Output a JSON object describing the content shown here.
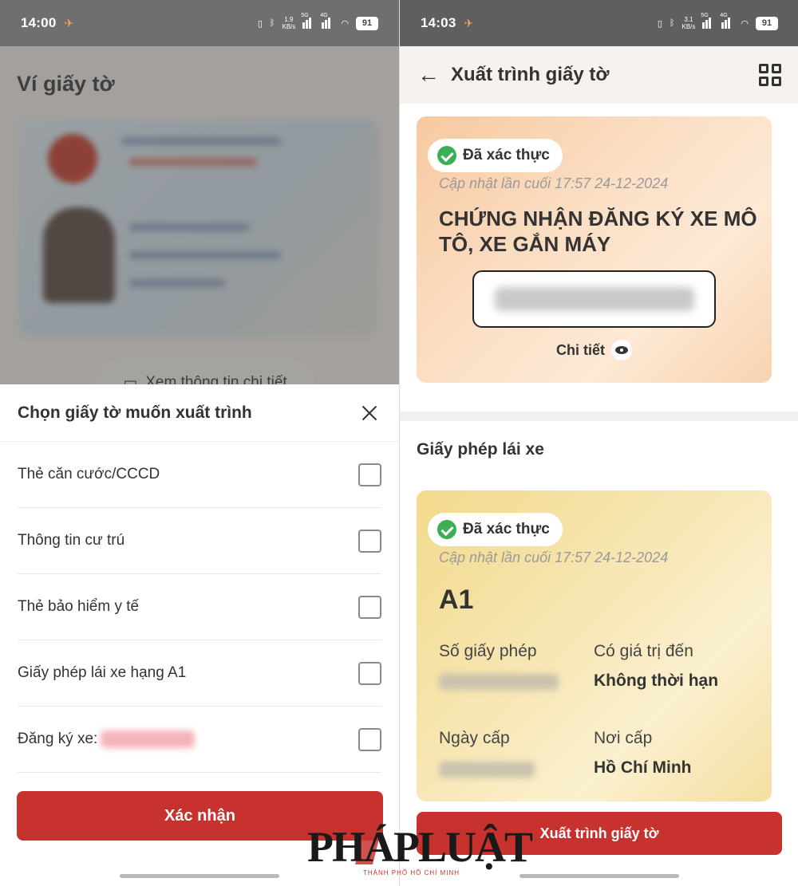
{
  "left": {
    "status": {
      "time": "14:00",
      "speed": "1.9",
      "speed_unit": "KB/s",
      "net1": "5G",
      "net2": "4G",
      "battery": "91"
    },
    "background": {
      "title": "Ví giấy tờ",
      "view_button": "Xem thông tin chi tiết"
    },
    "sheet": {
      "title": "Chọn giấy tờ muốn xuất trình",
      "options": [
        {
          "label": "Thẻ căn cước/CCCD"
        },
        {
          "label": "Thông tin cư trú"
        },
        {
          "label": "Thẻ bảo hiểm y tế"
        },
        {
          "label": "Giấy phép lái xe hạng A1"
        },
        {
          "label": "Đăng ký xe:"
        }
      ],
      "confirm_label": "Xác nhận"
    }
  },
  "right": {
    "status": {
      "time": "14:03",
      "speed": "3.1",
      "speed_unit": "KB/s",
      "net1": "5G",
      "net2": "4G",
      "battery": "91"
    },
    "header": {
      "title": "Xuất trình giấy tờ"
    },
    "registration_card": {
      "status": "Đã xác thực",
      "updated": "Cập nhật lần cuối 17:57 24-12-2024",
      "title": "CHỨNG NHẬN ĐĂNG KÝ XE MÔ TÔ, XE GẮN MÁY",
      "detail_link": "Chi tiết"
    },
    "license_section": {
      "title": "Giấy phép lái xe",
      "status": "Đã xác thực",
      "updated": "Cập nhật lần cuối 17:57 24-12-2024",
      "class": "A1",
      "license_no_label": "Số giấy phép",
      "valid_until_label": "Có giá trị đến",
      "valid_until_value": "Không thời hạn",
      "issue_date_label": "Ngày cấp",
      "issue_place_label": "Nơi cấp",
      "issue_place_value": "Hồ Chí Minh"
    },
    "present_label": "Xuất trình giấy tờ"
  },
  "watermark": {
    "text": "PHÁPLUẬT",
    "sub": "THÀNH PHỐ HỒ CHÍ MINH"
  },
  "colors": {
    "primary_red": "#c8322e",
    "verified_green": "#3cae56",
    "statusbar": "#6f6f6f"
  }
}
